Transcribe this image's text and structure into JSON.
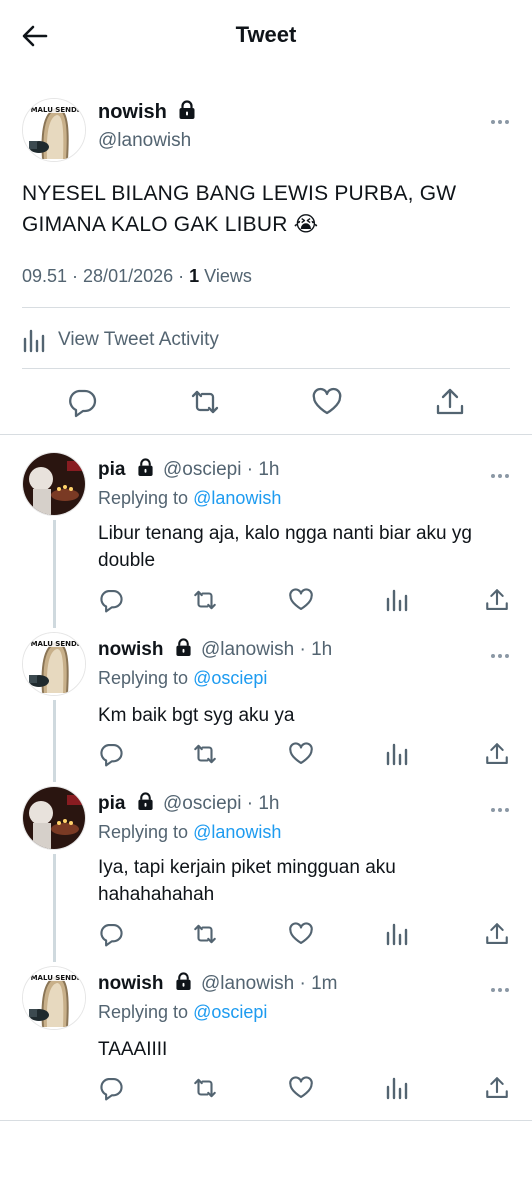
{
  "header": {
    "title": "Tweet",
    "back_icon": "arrow-left-icon"
  },
  "main_tweet": {
    "name": "nowish",
    "handle": "@lanowish",
    "avatar_text": "MALU SENDI",
    "text": "NYESEL BILANG BANG LEWIS PURBA, GW GIMANA KALO GAK LIBUR 😭",
    "time": "09.51 · 28/01/2026 ·",
    "views_count": "1",
    "views_label": "Views",
    "activity_label": "View Tweet Activity"
  },
  "replies": [
    {
      "name": "pia",
      "handle": "@osciepi · 1h",
      "replying_label": "Replying to",
      "replying_to": "@lanowish",
      "text": "Libur tenang aja, kalo ngga nanti biar aku yg double",
      "avatar": "pia"
    },
    {
      "name": "nowish",
      "handle": "@lanowish · 1h",
      "replying_label": "Replying to",
      "replying_to": "@osciepi",
      "text": "Km baik bgt syg aku ya",
      "avatar": "nowish",
      "avatar_text": "MALU SENDI"
    },
    {
      "name": "pia",
      "handle": "@osciepi · 1h",
      "replying_label": "Replying to",
      "replying_to": "@lanowish",
      "text": "Iya, tapi kerjain piket mingguan aku hahahahahah",
      "avatar": "pia"
    },
    {
      "name": "nowish",
      "handle": "@lanowish · 1m",
      "replying_label": "Replying to",
      "replying_to": "@osciepi",
      "text": "TAAAIIII",
      "avatar": "nowish",
      "avatar_text": "MALU SENDI"
    }
  ],
  "colors": {
    "link": "#1d9bf0",
    "muted": "#536471",
    "text": "#0f1419"
  }
}
